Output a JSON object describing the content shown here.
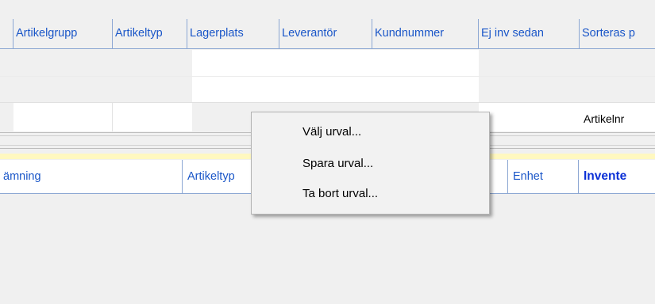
{
  "grid": {
    "columns": [
      "Artikelgrupp",
      "Artikeltyp",
      "Lagerplats",
      "Leverantör",
      "Kundnummer",
      "Ej inv sedan",
      "Sorteras p"
    ],
    "row3_sort_value": "Artikelnr"
  },
  "lower_grid": {
    "columns": [
      "ämning",
      "Artikeltyp",
      "Enhet",
      "Invente"
    ]
  },
  "context_menu": {
    "items": [
      "Välj urval...",
      "Spara urval...",
      "Ta bort urval..."
    ]
  }
}
